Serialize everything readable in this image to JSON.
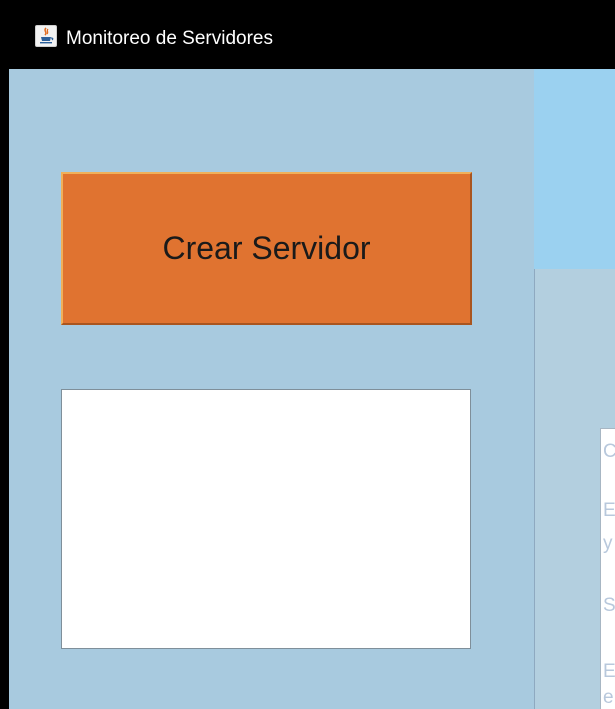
{
  "window": {
    "title": "Monitoreo de Servidores",
    "icon": "java-icon"
  },
  "left_panel": {
    "create_button_label": "Crear Servidor",
    "list_box_text": ""
  },
  "right_panel": {
    "text_fragments": [
      "C",
      "E",
      "y",
      "S",
      "E",
      "e"
    ]
  },
  "colors": {
    "titlebar": "#000000",
    "left_panel_bg": "#a8cadf",
    "button_bg": "#e07330",
    "right_top_bg": "#9bd1f0",
    "right_bottom_bg": "#b3cfdf",
    "faded_text": "#b8c8dc"
  }
}
